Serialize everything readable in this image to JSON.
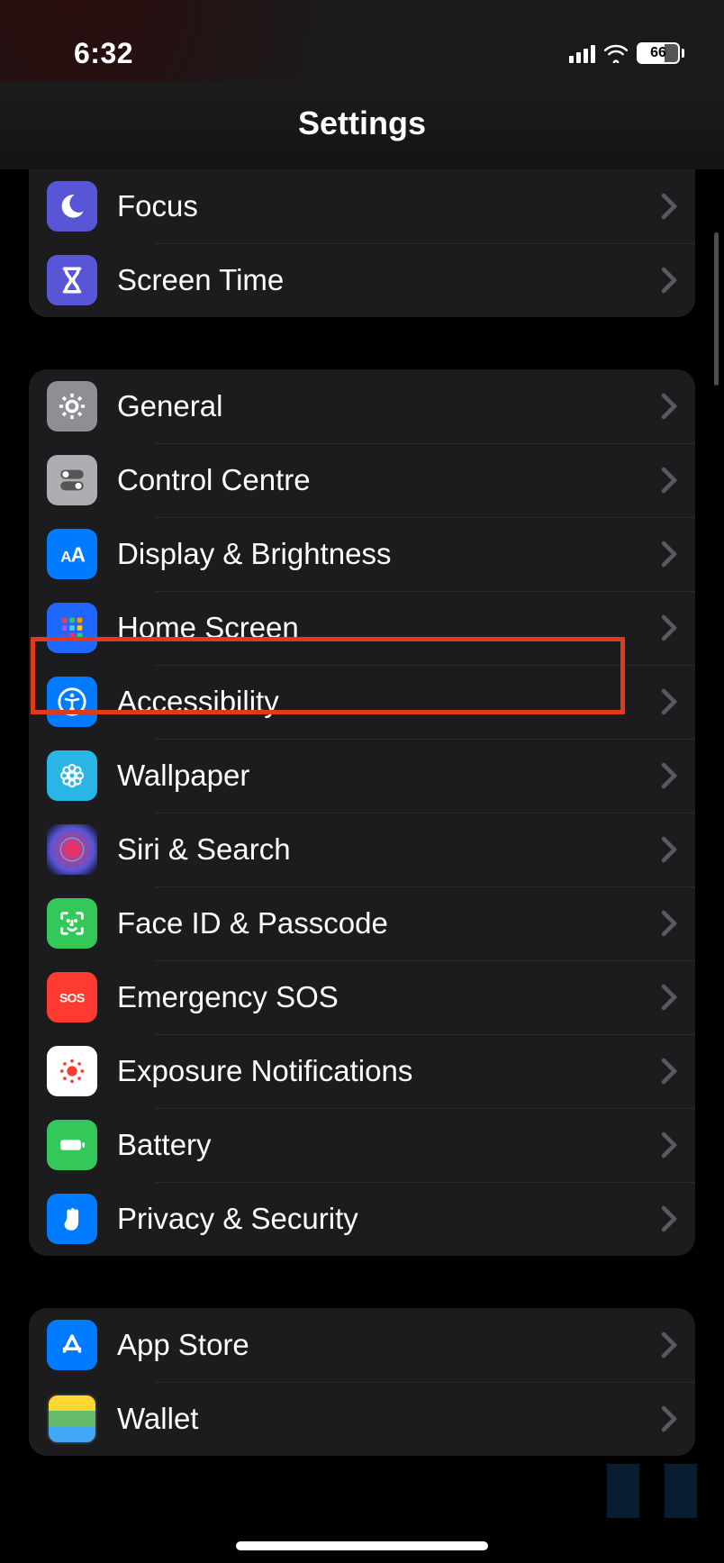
{
  "statusbar": {
    "time": "6:32",
    "battery_pct": "66"
  },
  "title": "Settings",
  "groups": [
    {
      "id": "g1",
      "rows": [
        {
          "id": "focus",
          "label": "Focus",
          "icon": "moon",
          "bg": "bg-indigo"
        },
        {
          "id": "screentime",
          "label": "Screen Time",
          "icon": "hourglass",
          "bg": "bg-indigo"
        }
      ]
    },
    {
      "id": "g2",
      "rows": [
        {
          "id": "general",
          "label": "General",
          "icon": "gear",
          "bg": "bg-gray"
        },
        {
          "id": "controlcentre",
          "label": "Control Centre",
          "icon": "toggles",
          "bg": "bg-lightgray"
        },
        {
          "id": "display",
          "label": "Display & Brightness",
          "icon": "aa",
          "bg": "bg-blue"
        },
        {
          "id": "homescreen",
          "label": "Home Screen",
          "icon": "grid",
          "bg": "bg-deepblue"
        },
        {
          "id": "accessibility",
          "label": "Accessibility",
          "icon": "accessibility",
          "bg": "bg-blue",
          "highlighted": true
        },
        {
          "id": "wallpaper",
          "label": "Wallpaper",
          "icon": "flower",
          "bg": "bg-cyan"
        },
        {
          "id": "siri",
          "label": "Siri & Search",
          "icon": "siri",
          "bg": "bg-siri"
        },
        {
          "id": "faceid",
          "label": "Face ID & Passcode",
          "icon": "faceid",
          "bg": "bg-green"
        },
        {
          "id": "sos",
          "label": "Emergency SOS",
          "icon": "sos",
          "bg": "bg-red"
        },
        {
          "id": "exposure",
          "label": "Exposure Notifications",
          "icon": "exposure",
          "bg": "bg-white"
        },
        {
          "id": "battery",
          "label": "Battery",
          "icon": "battery",
          "bg": "bg-green"
        },
        {
          "id": "privacy",
          "label": "Privacy & Security",
          "icon": "hand",
          "bg": "bg-blue"
        }
      ]
    },
    {
      "id": "g3",
      "rows": [
        {
          "id": "appstore",
          "label": "App Store",
          "icon": "appstore",
          "bg": "bg-blue"
        },
        {
          "id": "wallet",
          "label": "Wallet",
          "icon": "wallet",
          "bg": "bg-wallet"
        }
      ]
    }
  ]
}
